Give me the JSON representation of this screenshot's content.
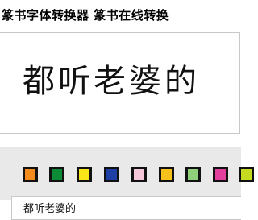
{
  "header": {
    "title": "篆书字体转换器  篆书在线转换"
  },
  "preview": {
    "converted_text": "都听老婆的"
  },
  "palette": {
    "colors": [
      {
        "name": "orange",
        "hex": "#f38a1c"
      },
      {
        "name": "green",
        "hex": "#0d8a36"
      },
      {
        "name": "yellow",
        "hex": "#f8e618"
      },
      {
        "name": "blue",
        "hex": "#1d3fa6"
      },
      {
        "name": "pink",
        "hex": "#f6c7d9"
      },
      {
        "name": "gold",
        "hex": "#f6c11a"
      },
      {
        "name": "light-green",
        "hex": "#8fd07b"
      },
      {
        "name": "magenta",
        "hex": "#e2409d"
      },
      {
        "name": "yellow-green",
        "hex": "#c7da22"
      }
    ]
  },
  "input": {
    "value": "都听老婆的"
  }
}
